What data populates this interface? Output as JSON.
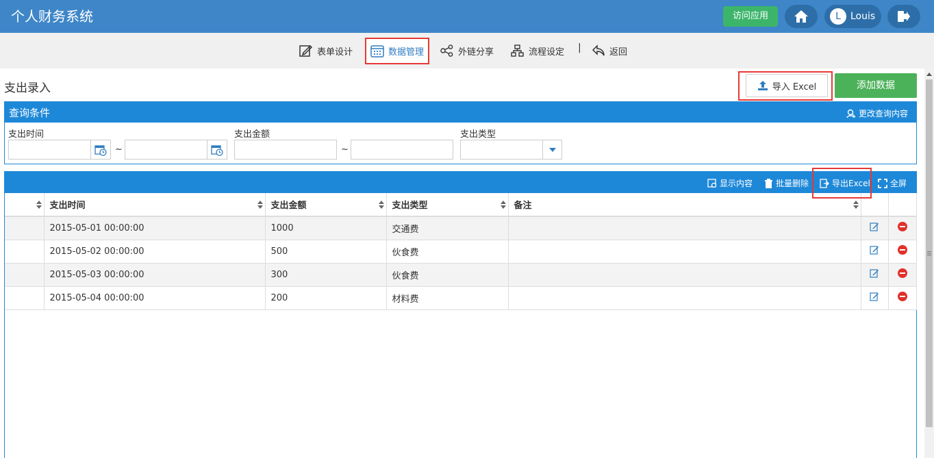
{
  "header": {
    "app_title": "个人财务系统",
    "visit_app": "访问应用",
    "user_initial": "L",
    "user_name": "Louis"
  },
  "toolbar": {
    "tabs": [
      {
        "label": "表单设计",
        "icon": "form-edit-icon"
      },
      {
        "label": "数据管理",
        "icon": "data-grid-icon",
        "active": true
      },
      {
        "label": "外链分享",
        "icon": "share-icon"
      },
      {
        "label": "流程设定",
        "icon": "workflow-icon"
      },
      {
        "label": "返回",
        "icon": "back-icon"
      }
    ],
    "separator": "|"
  },
  "page": {
    "title": "支出录入",
    "import_excel": "导入 Excel",
    "add_data": "添加数据"
  },
  "query": {
    "title": "查询条件",
    "change_query": "更改查询内容",
    "fields": [
      {
        "label": "支出时间",
        "type": "date-range"
      },
      {
        "label": "支出金额",
        "type": "number-range"
      },
      {
        "label": "支出类型",
        "type": "select"
      }
    ],
    "range_sep": "~"
  },
  "grid": {
    "actions": {
      "show_content": "显示内容",
      "batch_delete": "批量删除",
      "export_excel": "导出Excel",
      "fullscreen": "全屏"
    },
    "columns": [
      "支出时间",
      "支出金额",
      "支出类型",
      "备注"
    ],
    "rows": [
      {
        "time": "2015-05-01 00:00:00",
        "amount": "1000",
        "type": "交通费",
        "note": ""
      },
      {
        "time": "2015-05-02 00:00:00",
        "amount": "500",
        "type": "伙食费",
        "note": ""
      },
      {
        "time": "2015-05-03 00:00:00",
        "amount": "300",
        "type": "伙食费",
        "note": ""
      },
      {
        "time": "2015-05-04 00:00:00",
        "amount": "200",
        "type": "材料费",
        "note": ""
      }
    ]
  },
  "colors": {
    "header_bg": "#3e86c8",
    "panel_blue": "#1e88d8",
    "green": "#4cb25a",
    "highlight_red": "#e53935",
    "delete_red": "#e0312b"
  }
}
